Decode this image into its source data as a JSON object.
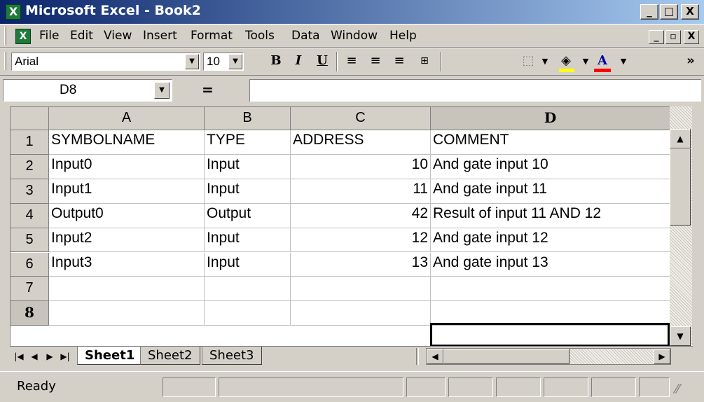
{
  "window": {
    "title": "Microsoft Excel - Book2",
    "min_label": "_",
    "max_label": "□",
    "close_label": "X"
  },
  "menu": {
    "items": [
      {
        "label": "File"
      },
      {
        "label": "Edit"
      },
      {
        "label": "View"
      },
      {
        "label": "Insert"
      },
      {
        "label": "Format"
      },
      {
        "label": "Tools"
      },
      {
        "label": "Data"
      },
      {
        "label": "Window"
      },
      {
        "label": "Help"
      }
    ]
  },
  "toolbar": {
    "font_name": "Arial",
    "font_size": "10",
    "bold_label": "B",
    "italic_label": "I",
    "underline_label": "U",
    "font_color_label": "A",
    "more_label": "»",
    "accent_yellow": "#ffff00",
    "accent_red": "#ff0000"
  },
  "formula_bar": {
    "cell_ref": "D8",
    "equals": "=",
    "value": ""
  },
  "grid": {
    "columns": [
      "A",
      "B",
      "C",
      "D"
    ],
    "row_numbers": [
      "1",
      "2",
      "3",
      "4",
      "5",
      "6",
      "7",
      "8"
    ],
    "rows": [
      [
        "SYMBOLNAME",
        "TYPE",
        "ADDRESS",
        "COMMENT"
      ],
      [
        "Input0",
        "Input",
        "10",
        "And gate input 10"
      ],
      [
        "Input1",
        "Input",
        "11",
        "And gate input 11"
      ],
      [
        "Output0",
        "Output",
        "42",
        "Result of input 11 AND 12"
      ],
      [
        "Input2",
        "Input",
        "12",
        "And gate input 12"
      ],
      [
        "Input3",
        "Input",
        "13",
        "And gate input 13"
      ],
      [
        "",
        "",
        "",
        ""
      ],
      [
        "",
        "",
        "",
        ""
      ]
    ],
    "active_cell": "D8"
  },
  "sheets": {
    "tabs": [
      {
        "label": "Sheet1"
      },
      {
        "label": "Sheet2"
      },
      {
        "label": "Sheet3"
      }
    ],
    "active": "Sheet1"
  },
  "status": {
    "text": "Ready"
  }
}
